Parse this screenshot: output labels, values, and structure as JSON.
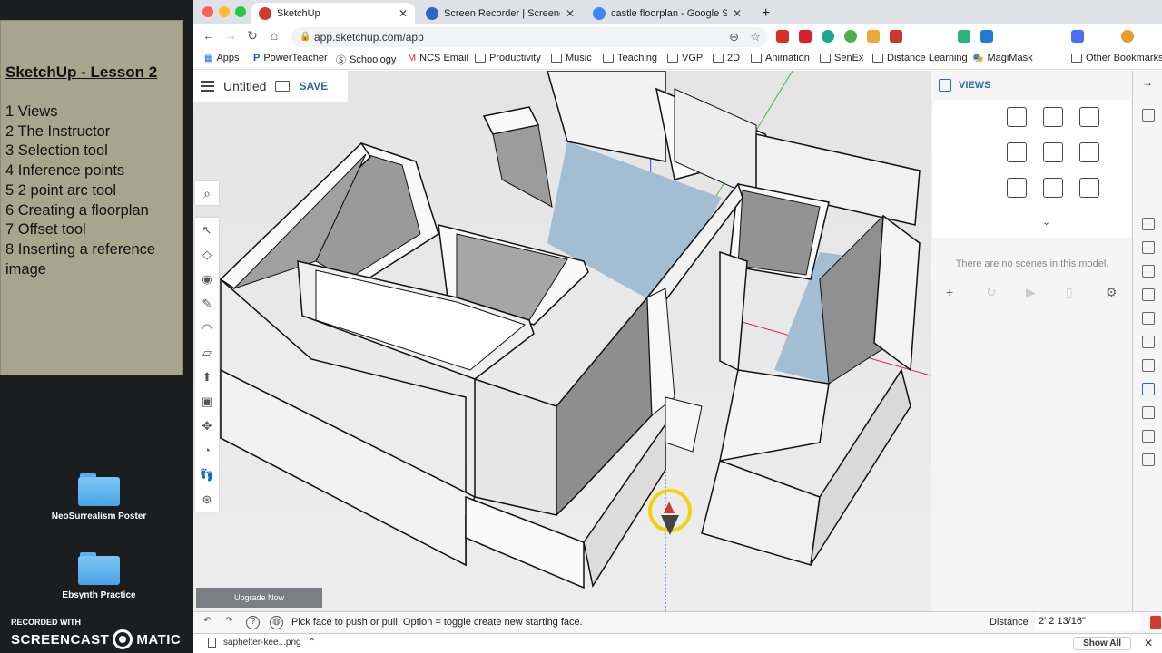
{
  "lesson": {
    "title": "SketchUp - Lesson 2",
    "items": [
      "1 Views",
      "2 The Instructor",
      "3 Selection tool",
      "4 Inference points",
      "5 2 point arc tool",
      "6 Creating a floorplan",
      "7 Offset tool",
      "8 Inserting a reference image"
    ]
  },
  "desktop": {
    "folders": [
      {
        "label": "NeoSurrealism Poster"
      },
      {
        "label": "Ebsynth Practice"
      }
    ],
    "recorded_label": "RECORDED WITH",
    "screencast_left": "SCREENCAST",
    "screencast_right": "MATIC"
  },
  "browser": {
    "tabs": [
      {
        "title": "SketchUp",
        "icon": "sketchup-icon",
        "color": "#d63a2c"
      },
      {
        "title": "Screen Recorder | Screencast...",
        "icon": "screencast-icon",
        "color": "#2d66c5"
      },
      {
        "title": "castle floorplan - Google Sear...",
        "icon": "google-icon",
        "color": "#4285f4"
      }
    ],
    "url": "app.sketchup.com/app",
    "bookmarks": [
      "Apps",
      "PowerTeacher",
      "Schoology",
      "NCS Email",
      "Productivity",
      "Music",
      "Teaching",
      "VGP",
      "2D",
      "Animation",
      "SenEx",
      "Distance Learning",
      "MagiMask",
      "Other Bookmarks"
    ]
  },
  "sketchup": {
    "doc_title": "Untitled",
    "save_label": "SAVE",
    "upgrade_label": "Upgrade Now",
    "panel_title": "VIEWS",
    "no_scenes": "There are no scenes in this model.",
    "status_message": "Pick face to push or pull. Option = toggle create new starting face.",
    "distance_label": "Distance",
    "distance_value": "2' 2 13/16\""
  },
  "downloads": {
    "file": "saphelter-kee...png",
    "show_all": "Show All"
  },
  "colors": {
    "accent": "#2f6aa8",
    "floor": "#a3bdd3",
    "sticky": "#a9a48d"
  }
}
